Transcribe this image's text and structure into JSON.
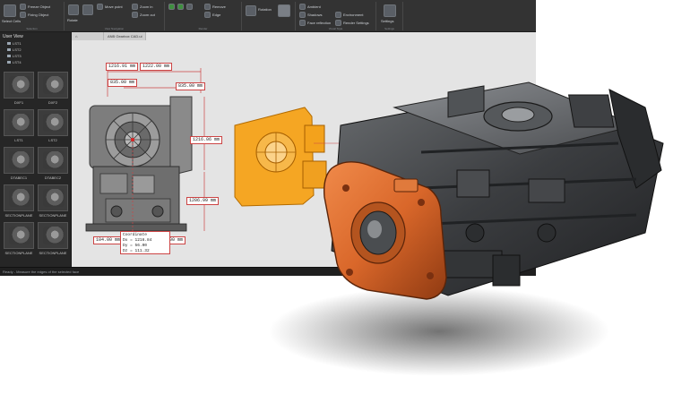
{
  "app": {
    "tab_title": "ANB Gearbox CAD.ui"
  },
  "ribbon": {
    "items": {
      "select_cells": "Select Cells",
      "freeze_object": "Freeze Object",
      "fixing_object": "Fixing Object",
      "rotate": "Rotate",
      "move_point": "Move point",
      "zoom_in": "Zoom in",
      "zoom_out": "Zoom out",
      "remove": "Remove",
      "ambient": "Ambient",
      "shadows": "Shadows",
      "face_reflection": "Face reflection",
      "environment": "Environment",
      "render_settings": "Render Settings",
      "rotation": "Rotation",
      "edge": "Edge",
      "settings": "Settings"
    },
    "groups": [
      "Selection",
      "View Navigation",
      "Render",
      "Visual Style",
      "Settings"
    ]
  },
  "left_panel": {
    "title": "User View",
    "tree_items": [
      "LST1",
      "LST2",
      "LST3",
      "LST4"
    ],
    "thumbnails": [
      {
        "label": "DXF1"
      },
      {
        "label": "DXF2"
      },
      {
        "label": "LST1"
      },
      {
        "label": "LST2"
      },
      {
        "label": "DTABEC1"
      },
      {
        "label": "DTABEC2"
      },
      {
        "label": "SECTIONPLANE"
      },
      {
        "label": "SECTIONPLANE"
      },
      {
        "label": "SECTIONPLANE"
      },
      {
        "label": "SECTIONPLANE"
      }
    ]
  },
  "status": {
    "text": "Ready - Measure the edges of the selected face"
  },
  "drawing": {
    "dimensions": {
      "top_left": "1216.91 mm",
      "top_right": "1222.00 mm",
      "upper_left": "835.00 mm",
      "upper_right": "835.00 mm",
      "right_upper": "1216.06 mm",
      "right_lower": "1206.99 mm",
      "bottom_left": "104.00 mm",
      "bottom_right": "600.00 mm"
    },
    "coordinates": {
      "title": "Coordinate",
      "dx": "Dx = 1216.84",
      "dy": "Dy = 56.00",
      "dz": "Dz = 111.32"
    }
  },
  "colors": {
    "accent_orange": "#d9672a",
    "highlight_yellow": "#f5a623",
    "app_dark": "#2b2b2b",
    "viewport_bg": "#e4e4e4",
    "dimension_red": "#cc4444"
  }
}
